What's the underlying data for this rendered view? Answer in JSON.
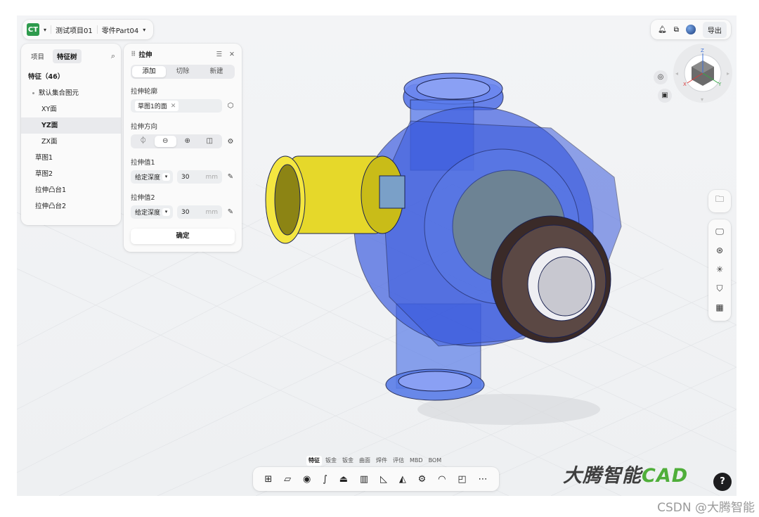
{
  "header": {
    "logo": "CT",
    "project": "测试项目01",
    "part": "零件Part04"
  },
  "topright": {
    "bell_icon": "bell-icon",
    "share_icon": "share-icon",
    "export_label": "导出"
  },
  "tree": {
    "tabs": [
      "项目",
      "特征树"
    ],
    "search_icon": "search-icon",
    "header": "特征（46）",
    "items": [
      {
        "label": "默认集合图元"
      },
      {
        "label": "XY面"
      },
      {
        "label": "YZ面"
      },
      {
        "label": "ZX面"
      },
      {
        "label": "草图1"
      },
      {
        "label": "草图2"
      },
      {
        "label": "拉伸凸台1"
      },
      {
        "label": "拉伸凸台2"
      }
    ]
  },
  "extrude": {
    "title": "拉伸",
    "modes": [
      "添加",
      "切除",
      "新建"
    ],
    "profile_label": "拉伸轮廓",
    "profile_chip": "草图1的面",
    "direction_label": "拉伸方向",
    "value1_label": "拉伸值1",
    "value1_type": "给定深度",
    "value1": "30",
    "value2_label": "拉伸值2",
    "value2_type": "给定深度",
    "value2": "30",
    "unit": "mm",
    "confirm_label": "确定"
  },
  "viewcube": {
    "z": "Z",
    "x": "X",
    "y": "Y"
  },
  "bottom_tabs": [
    "特征",
    "钣金",
    "钣金",
    "曲面",
    "焊件",
    "评估",
    "MBD",
    "BOM"
  ],
  "brand": {
    "prefix": "大腾智能",
    "cad": "CAD"
  },
  "help_label": "?",
  "watermark": "CSDN @大腾智能"
}
